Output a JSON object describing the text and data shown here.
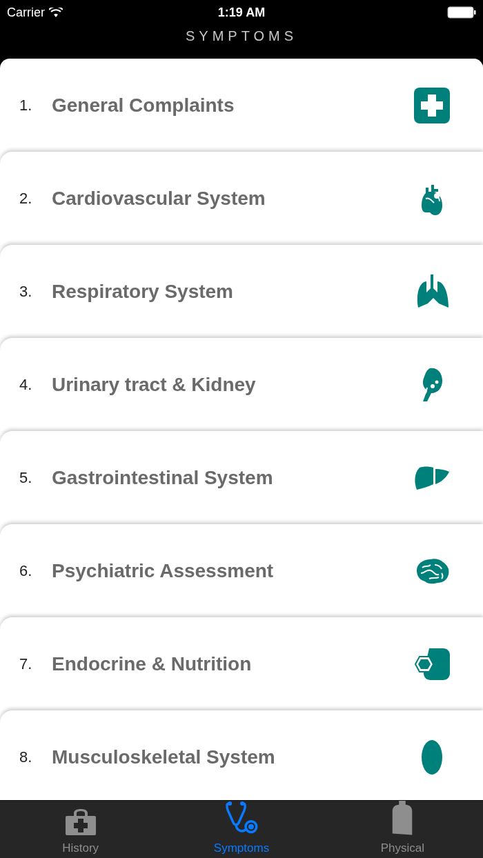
{
  "status_bar": {
    "carrier": "Carrier",
    "time": "1:19 AM"
  },
  "title": "SYMPTOMS",
  "items": [
    {
      "number": "1.",
      "label": "General Complaints"
    },
    {
      "number": "2.",
      "label": "Cardiovascular System"
    },
    {
      "number": "3.",
      "label": "Respiratory System"
    },
    {
      "number": "4.",
      "label": "Urinary tract & Kidney"
    },
    {
      "number": "5.",
      "label": "Gastrointestinal System"
    },
    {
      "number": "6.",
      "label": "Psychiatric Assessment"
    },
    {
      "number": "7.",
      "label": "Endocrine & Nutrition"
    },
    {
      "number": "8.",
      "label": "Musculoskeletal System"
    }
  ],
  "tabs": [
    {
      "label": "History",
      "selected": false
    },
    {
      "label": "Symptoms",
      "selected": true
    },
    {
      "label": "Physical",
      "selected": false
    }
  ]
}
